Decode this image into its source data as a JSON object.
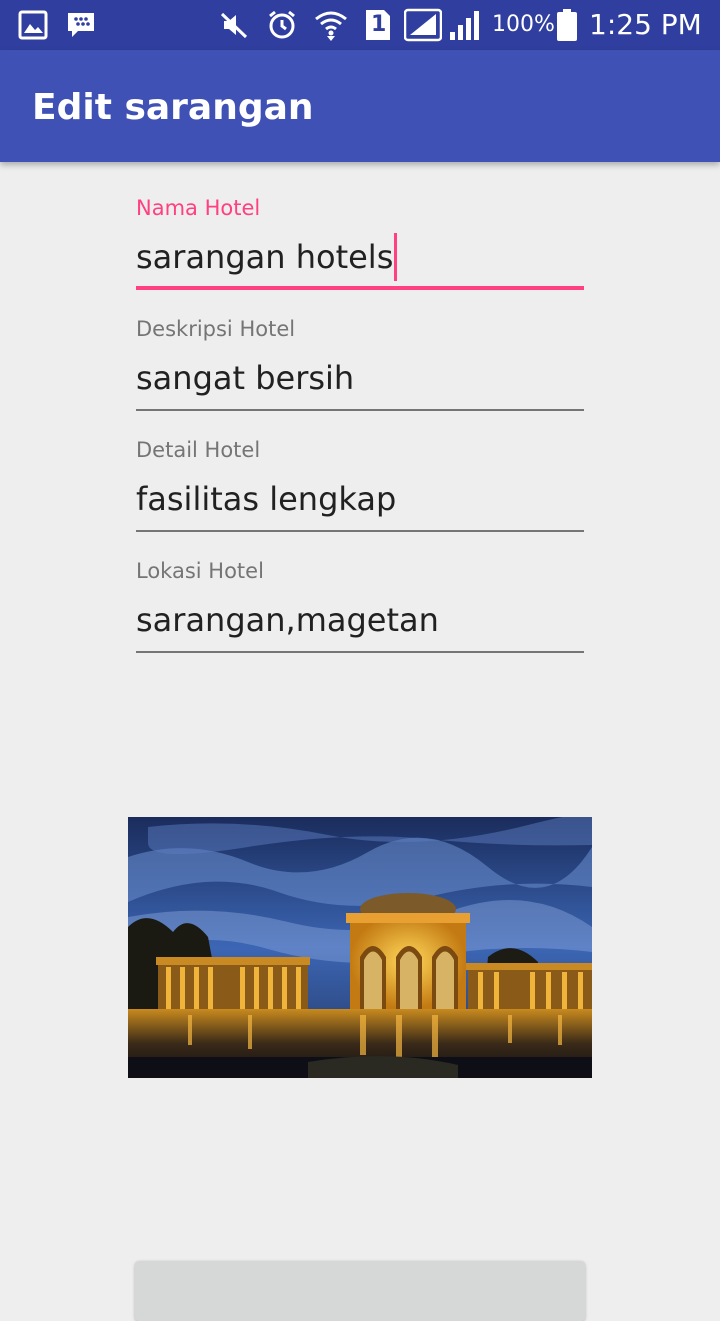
{
  "status_bar": {
    "battery_percent": "100%",
    "time": "1:25 PM",
    "sim_slot": "1",
    "icons": [
      "gallery-icon",
      "bbm-icon",
      "mute-icon",
      "alarm-icon",
      "wifi-icon",
      "sim-icon",
      "signal-icon",
      "signal-icon",
      "battery-icon"
    ]
  },
  "app_bar": {
    "title": "Edit sarangan",
    "color": "#3f51b5",
    "status_color": "#303f9f"
  },
  "form": {
    "nama_hotel": {
      "label": "Nama Hotel",
      "value": "sarangan hotels"
    },
    "deskripsi_hotel": {
      "label": "Deskripsi Hotel",
      "value": "sangat bersih"
    },
    "detail_hotel": {
      "label": "Detail Hotel",
      "value": "fasilitas lengkap"
    },
    "lokasi_hotel": {
      "label": "Lokasi Hotel",
      "value": "sarangan,magetan"
    }
  },
  "accent_color": "#ff4081"
}
